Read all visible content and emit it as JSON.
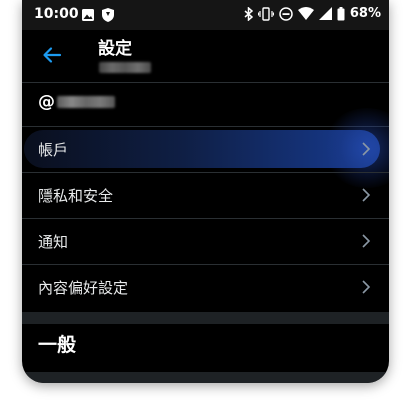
{
  "status_bar": {
    "time": "10:00",
    "battery_percent": "68%",
    "left_icons": [
      "image-icon",
      "shield-icon"
    ],
    "right_icons": [
      "bluetooth-icon",
      "vibrate-icon",
      "do-not-disturb-icon",
      "wifi-icon",
      "signal-icon",
      "battery-icon"
    ]
  },
  "header": {
    "title": "設定",
    "back_icon": "back-arrow-icon"
  },
  "account": {
    "handle_prefix": "@"
  },
  "menu": {
    "items": [
      {
        "label": "帳戶",
        "icon": "chevron-right-icon",
        "selected": true
      },
      {
        "label": "隱私和安全",
        "icon": "chevron-right-icon",
        "selected": false
      },
      {
        "label": "通知",
        "icon": "chevron-right-icon",
        "selected": false
      },
      {
        "label": "內容偏好設定",
        "icon": "chevron-right-icon",
        "selected": false
      }
    ]
  },
  "section": {
    "title": "一般"
  },
  "colors": {
    "accent": "#1d9bf0",
    "background": "#000000",
    "highlight": "#15347e",
    "divider": "#2a2f33"
  }
}
